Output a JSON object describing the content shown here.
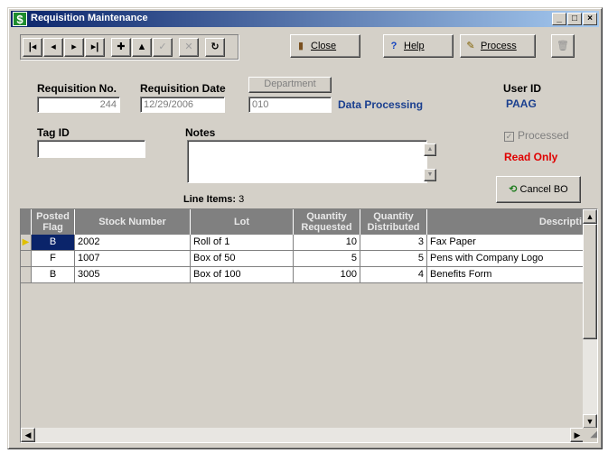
{
  "window": {
    "title": "Requisition Maintenance",
    "app_icon": "$",
    "controls": {
      "minimize": "_",
      "maximize": "□",
      "close": "×"
    }
  },
  "nav": {
    "first": "|◂",
    "prev": "◂",
    "next": "▸",
    "last": "▸|",
    "add": "✚",
    "up": "▲",
    "save": "✓",
    "cancel": "✕",
    "refresh": "↻"
  },
  "toolbar": {
    "close_label": "Close",
    "help_label": "Help",
    "process_label": "Process"
  },
  "form": {
    "requisition_no_label": "Requisition No.",
    "requisition_no": "244",
    "requisition_date_label": "Requisition Date",
    "requisition_date": "12/29/2006",
    "department_button": "Department",
    "department_code": "010",
    "department_name": "Data Processing",
    "user_id_label": "User ID",
    "user_id": "PAAG",
    "tag_id_label": "Tag ID",
    "tag_id": "",
    "notes_label": "Notes",
    "notes": "",
    "processed_label": "Processed",
    "read_only": "Read Only",
    "cancel_bo": "Cancel BO",
    "line_items_label": "Line Items:",
    "line_items_count": "3"
  },
  "grid": {
    "headers": {
      "posted_flag": "Posted Flag",
      "stock_number": "Stock Number",
      "lot": "Lot",
      "qty_requested": "Quantity Requested",
      "qty_distributed": "Quantity Distributed",
      "description": "Descripti"
    },
    "rows": [
      {
        "flag": "B",
        "stock": "2002",
        "lot": "Roll of 1",
        "req": "10",
        "dist": "3",
        "desc": "Fax Paper"
      },
      {
        "flag": "F",
        "stock": "1007",
        "lot": "Box of 50",
        "req": "5",
        "dist": "5",
        "desc": "Pens with Company Logo"
      },
      {
        "flag": "B",
        "stock": "3005",
        "lot": "Box of 100",
        "req": "100",
        "dist": "4",
        "desc": "Benefits Form"
      }
    ]
  }
}
